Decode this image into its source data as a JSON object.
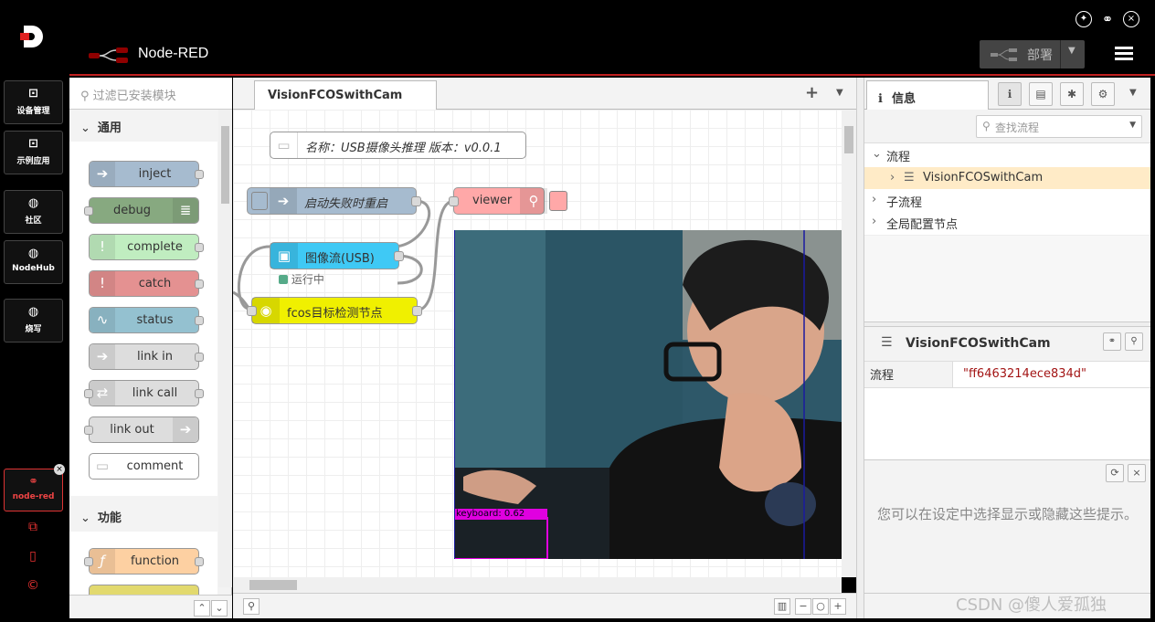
{
  "rail": {
    "items": [
      {
        "label": "设备管理",
        "icon": "inbox-icon"
      },
      {
        "label": "示例应用",
        "icon": "inbox-icon"
      },
      {
        "label": "社区",
        "icon": "chat-icon"
      },
      {
        "label": "NodeHub",
        "icon": "chat-icon"
      },
      {
        "label": "烧写",
        "icon": "chat-icon"
      }
    ],
    "active": {
      "label": "node-red",
      "icon": "link-icon"
    }
  },
  "header": {
    "title": "Node-RED",
    "deploy_label": "部署"
  },
  "palette": {
    "search_placeholder": "过滤已安装模块",
    "cat_common": "通用",
    "cat_function": "功能",
    "nodes": [
      {
        "label": "inject",
        "color": "#a6bbcf"
      },
      {
        "label": "debug",
        "color": "#87a980"
      },
      {
        "label": "complete",
        "color": "#c0edc0"
      },
      {
        "label": "catch",
        "color": "#e49191"
      },
      {
        "label": "status",
        "color": "#94c1d0"
      },
      {
        "label": "link in",
        "color": "#dddddd"
      },
      {
        "label": "link call",
        "color": "#dddddd"
      },
      {
        "label": "link out",
        "color": "#dddddd"
      },
      {
        "label": "comment",
        "color": "#ffffff"
      },
      {
        "label": "function",
        "color": "#fdd0a2"
      }
    ]
  },
  "workspace": {
    "tab_label": "VisionFCOSwithCam",
    "comment_node": "名称：USB摄像头推理 版本：v0.0.1",
    "restart_node": "启动失败时重启",
    "viewer_node": "viewer",
    "usb_node": "图像流(USB)",
    "usb_status": "运行中",
    "fcos_node": "fcos目标检测节点",
    "detection_label": "keyboard: 0.62"
  },
  "sidebar": {
    "tab_label": "信息",
    "search_placeholder": "查找流程",
    "tree": {
      "flows": "流程",
      "flow_item": "VisionFCOSwithCam",
      "subflows": "子流程",
      "global_config": "全局配置节点"
    },
    "info_title": "VisionFCOSwithCam",
    "info_key": "流程",
    "info_value": "\"ff6463214ece834d\"",
    "tip_text": "您可以在设定中选择显示或隐藏这些提示。"
  },
  "watermark": "CSDN @傻人爱孤独",
  "colors": {
    "accent": "#c02020",
    "selected_row": "#ffebc7",
    "node_usb": "#3fc9f5",
    "node_fcos": "#f0f000",
    "node_viewer": "#ffa8a8"
  }
}
